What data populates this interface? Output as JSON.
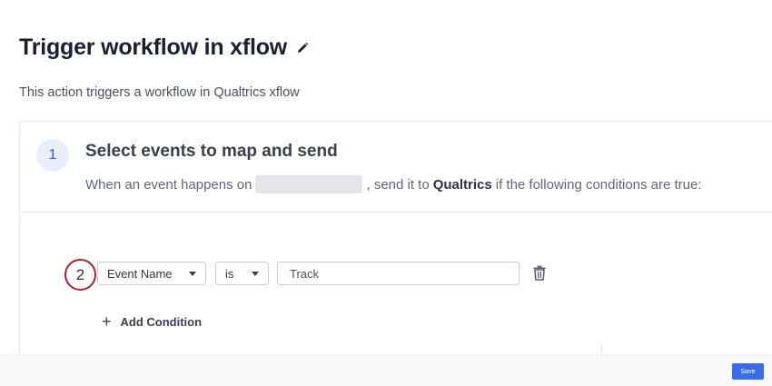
{
  "header": {
    "title": "Trigger workflow in xflow",
    "edit_icon": "pencil-icon",
    "subtitle": "This action triggers a workflow in Qualtrics xflow"
  },
  "step": {
    "number": "1",
    "title": "Select events to map and send",
    "desc_prefix": "When an event happens on",
    "desc_middle": ", send it to",
    "destination": "Qualtrics",
    "desc_suffix": "if the following conditions are true:"
  },
  "annotation": {
    "marker": "2",
    "color": "#a6232f"
  },
  "condition": {
    "field": "Event Name",
    "operator": "is",
    "value": "Track",
    "delete_icon": "trash-icon"
  },
  "add_condition": {
    "icon": "plus-icon",
    "label": "Add Condition"
  },
  "footer": {
    "save_label": "Save",
    "accent": "#3b6ce8"
  }
}
